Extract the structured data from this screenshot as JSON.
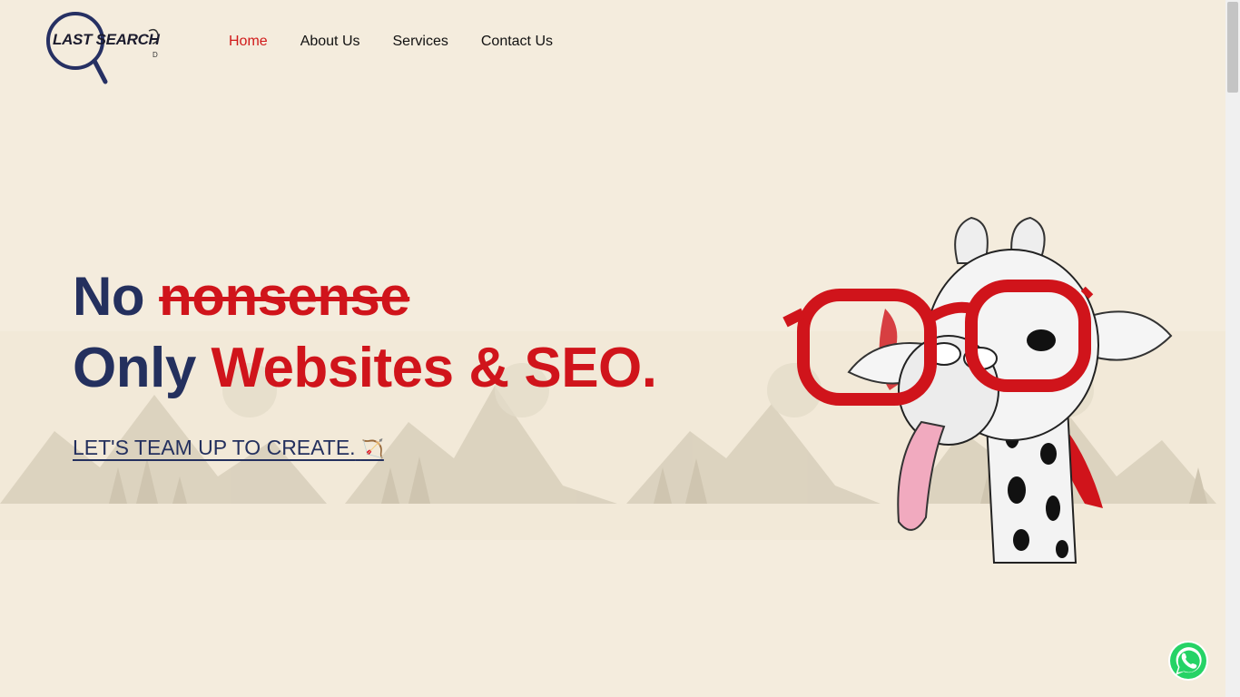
{
  "brand": {
    "logo_text": "LAST SEARCH",
    "logo_sub": "D"
  },
  "nav": [
    {
      "label": "Home",
      "active": true
    },
    {
      "label": "About Us",
      "active": false
    },
    {
      "label": "Services",
      "active": false
    },
    {
      "label": "Contact Us",
      "active": false
    }
  ],
  "hero": {
    "word_no": "No",
    "word_struck": "nonsense",
    "word_only": "Only",
    "highlight": "Websites & SEO.",
    "cta_label": "LET'S TEAM UP TO CREATE.",
    "cta_emoji": "🏹"
  },
  "colors": {
    "accent": "#d0141b",
    "navy": "#24305e",
    "background": "#f4ecdd",
    "whatsapp": "#25d366"
  },
  "icons": {
    "logo": "magnifier-icon",
    "whatsapp": "whatsapp-icon",
    "mascot": "giraffe-with-glasses"
  }
}
